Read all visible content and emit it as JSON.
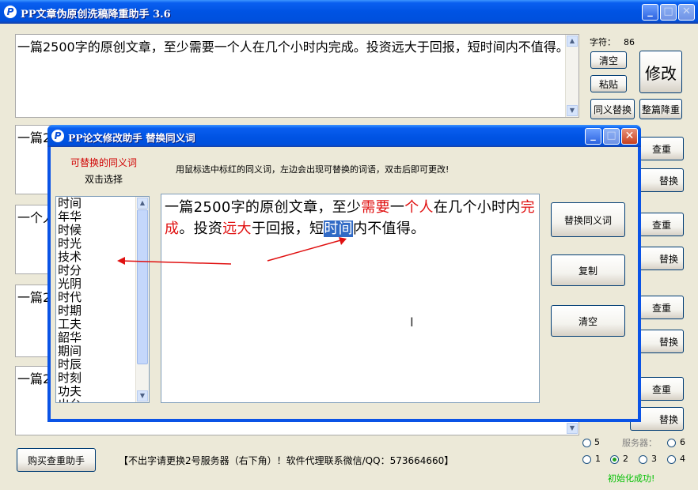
{
  "app": {
    "title": "PP文章伪原创洗稿降重助手 3.6",
    "icon": "pp-logo-icon"
  },
  "main": {
    "box1_text": "一篇2500字的原创文章，至少需要一个人在几个小时内完成。投资远大于回报，短时间内不值得。",
    "box_partial": [
      "一篇2",
      "一个人",
      "一篇2",
      "一篇2"
    ],
    "char_count_label": "字符：",
    "char_count_value": "86",
    "clear_label": "清空",
    "paste_label": "粘贴",
    "modify_label": "修改",
    "synonym_replace_label": "同义替换",
    "full_reduce_label": "整篇降重",
    "check_label": "查重",
    "replace_partial": "替换",
    "buy_label": "购买查重助手",
    "notice": "【不出字请更换2号服务器（右下角）！软件代理联系微信/QQ：573664660】",
    "server_label": "服务器：",
    "servers": [
      "5",
      "6",
      "1",
      "2",
      "3",
      "4"
    ],
    "selected_server": "2",
    "status": "初始化成功!"
  },
  "dialog": {
    "title": "PP论文修改助手 替换同义词",
    "alt_label": "可替换的同义词",
    "dbl_label": "双击选择",
    "hint": "用鼠标选中标红的同义词，左边会出现可替换的词语，双击后即可更改!",
    "synonyms": [
      "时间",
      "年华",
      "时候",
      "时光",
      "技术",
      "时分",
      "光阴",
      "时代",
      "时期",
      "工夫",
      "韶华",
      "期间",
      "时辰",
      "时刻",
      "功夫",
      "出台"
    ],
    "editor_segments": [
      {
        "t": "一篇2500字的原创文章，至少",
        "s": "normal"
      },
      {
        "t": "需要",
        "s": "red"
      },
      {
        "t": "一",
        "s": "normal"
      },
      {
        "t": "个人",
        "s": "red"
      },
      {
        "t": "在几个小时内",
        "s": "normal"
      },
      {
        "t": "完成",
        "s": "red"
      },
      {
        "t": "。投资",
        "s": "normal"
      },
      {
        "t": "远大",
        "s": "red"
      },
      {
        "t": "于回报，短",
        "s": "normal"
      },
      {
        "t": "时间",
        "s": "selected"
      },
      {
        "t": "内不值得。",
        "s": "normal"
      }
    ],
    "replace_label": "替换同义词",
    "copy_label": "复制",
    "clear_label": "清空"
  },
  "colors": {
    "titlebar": "#0053e3",
    "highlight_red": "#e01010",
    "selection": "#316ac5",
    "status_green": "#00c000",
    "alt_label_red": "#d00000"
  }
}
